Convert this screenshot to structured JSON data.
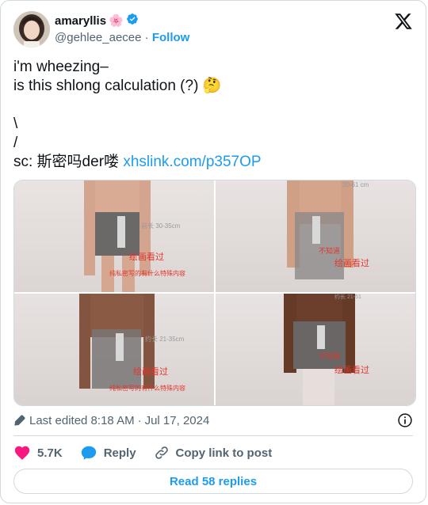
{
  "author": {
    "display_name": "amaryllis",
    "name_emoji": "🌸",
    "verified": true,
    "handle": "@gehlee_aecee",
    "separator": "·",
    "follow_label": "Follow"
  },
  "tweet": {
    "lines": [
      "i'm wheezing–",
      "is this shlong calculation (?) 🤔",
      "",
      "\\",
      "/"
    ],
    "source_prefix": "sc: 斯密吗der喽 ",
    "source_link": "xhslink.com/p357OP"
  },
  "media": {
    "images": [
      {
        "labels": [
          "前长 30-35cm",
          "绘画看过",
          "纯私密写的有什么特殊内容"
        ]
      },
      {
        "labels": [
          "30-61 cm",
          "不知道",
          "绘画看过"
        ]
      },
      {
        "labels": [
          "约长 21-35cm",
          "绘画看过",
          "纯私密写的有什么特殊内容"
        ]
      },
      {
        "labels": [
          "约长 21-51",
          "不知道",
          "绘画看过"
        ]
      }
    ]
  },
  "meta": {
    "edited_label": "Last edited 8:18 AM",
    "separator": "·",
    "date": "Jul 17, 2024"
  },
  "actions": {
    "likes": "5.7K",
    "reply": "Reply",
    "copy_link": "Copy link to post"
  },
  "read_replies": "Read 58 replies",
  "colors": {
    "accent": "#1d9bf0",
    "like": "#f91880",
    "text": "#0f1419",
    "muted": "#536471",
    "border": "#cfd9de",
    "annotation_red": "#e0362c"
  },
  "icons": [
    "x-logo-icon",
    "verified-badge-icon",
    "pencil-icon",
    "info-icon",
    "heart-icon",
    "reply-bubble-icon",
    "link-icon"
  ]
}
